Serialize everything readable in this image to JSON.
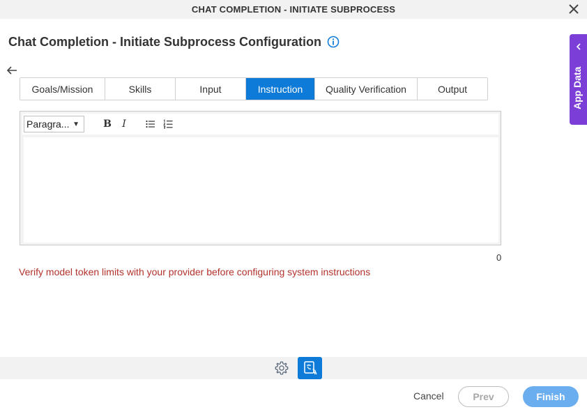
{
  "window": {
    "title": "CHAT COMPLETION - INITIATE SUBPROCESS",
    "close_icon": "close-icon"
  },
  "header": {
    "title": "Chat Completion - Initiate Subprocess Configuration",
    "info_icon": "info-icon"
  },
  "tabs": [
    {
      "label": "Goals/Mission",
      "active": false
    },
    {
      "label": "Skills",
      "active": false
    },
    {
      "label": "Input",
      "active": false
    },
    {
      "label": "Instruction",
      "active": true
    },
    {
      "label": "Quality Verification",
      "active": false
    },
    {
      "label": "Output",
      "active": false
    }
  ],
  "editor": {
    "paragraph_select": "Paragra...",
    "bold_label": "B",
    "italic_label": "I",
    "content": "",
    "char_count": "0"
  },
  "warning": "Verify model token limits with your provider before configuring system instructions",
  "footer": {
    "cancel": "Cancel",
    "prev": "Prev",
    "finish": "Finish"
  },
  "side_panel": {
    "label": "App Data"
  },
  "colors": {
    "accent": "#0f7bd8",
    "warning": "#b3322c",
    "side_panel": "#7b3fd8",
    "finish": "#6aaef0"
  }
}
